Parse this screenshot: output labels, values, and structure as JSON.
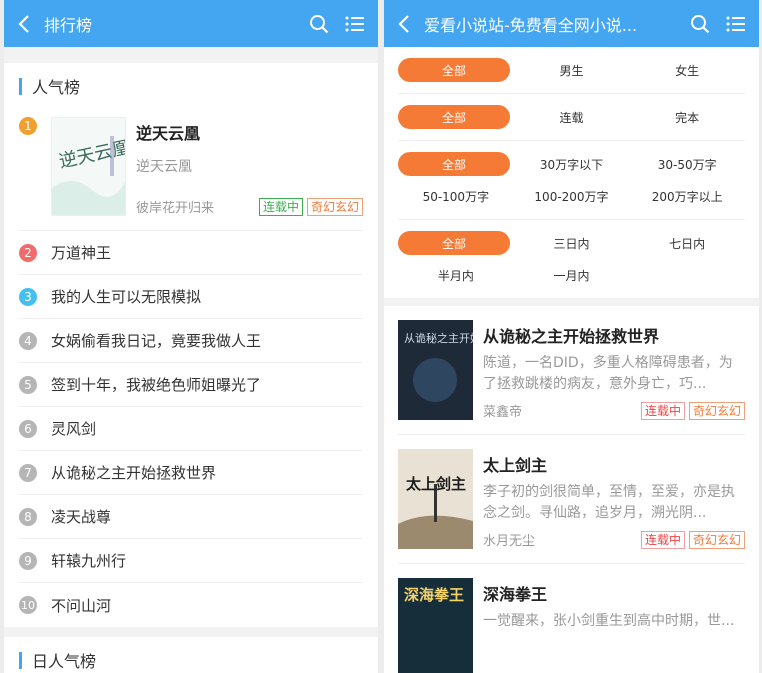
{
  "left": {
    "title": "排行榜",
    "section1_title": "人气榜",
    "section2_title": "日人气榜",
    "top": {
      "rank": "1",
      "name": "逆天云凰",
      "subtitle": "逆天云凰",
      "author": "彼岸花开归来",
      "status": "连载中",
      "genre": "奇幻玄幻",
      "cover_text": "逆天云凰"
    },
    "items": [
      {
        "rank": "2",
        "name": "万道神王"
      },
      {
        "rank": "3",
        "name": "我的人生可以无限模拟"
      },
      {
        "rank": "4",
        "name": "女娲偷看我日记，竟要我做人王"
      },
      {
        "rank": "5",
        "name": "签到十年，我被绝色师姐曝光了"
      },
      {
        "rank": "6",
        "name": "灵风剑"
      },
      {
        "rank": "7",
        "name": "从诡秘之主开始拯救世界"
      },
      {
        "rank": "8",
        "name": "凌天战尊"
      },
      {
        "rank": "9",
        "name": "轩辕九州行"
      },
      {
        "rank": "10",
        "name": "不问山河"
      }
    ]
  },
  "right": {
    "title": "爱看小说站-免费看全网小说...",
    "filters": [
      [
        "全部",
        "男生",
        "女生"
      ],
      [
        "全部",
        "连载",
        "完本"
      ],
      [
        "全部",
        "30万字以下",
        "30-50万字",
        "50-100万字",
        "100-200万字",
        "200万字以上"
      ],
      [
        "全部",
        "三日内",
        "七日内",
        "半月内",
        "一月内"
      ]
    ],
    "books": [
      {
        "name": "从诡秘之主开始拯救世界",
        "desc": "陈道，一名DID，多重人格障碍患者，为了拯救跳楼的病友，意外身亡，巧...",
        "author": "菜鑫帝",
        "status": "连载中",
        "genre": "奇幻玄幻",
        "cover_text": "从诡秘之主开始拯救世界"
      },
      {
        "name": "太上剑主",
        "desc": "李子初的剑很简单，至情，至爱，亦是执念之剑。寻仙路，追岁月，溯光阴...",
        "author": "水月无尘",
        "status": "连载中",
        "genre": "奇幻玄幻",
        "cover_text": "太上剑主"
      },
      {
        "name": "深海拳王",
        "desc": "一觉醒来，张小剑重生到高中时期，世...",
        "cover_text": "深海拳王"
      }
    ]
  },
  "colors": {
    "header": "#44a6f0",
    "accent": "#f57a35"
  }
}
